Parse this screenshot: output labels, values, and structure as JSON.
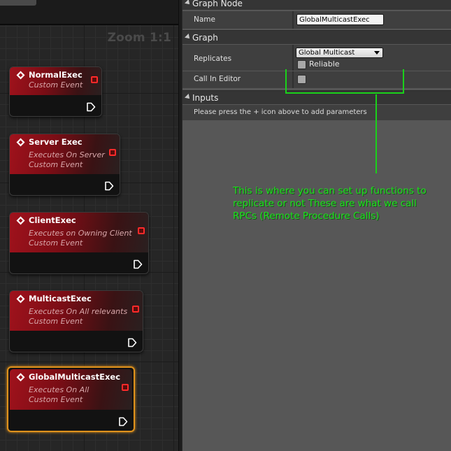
{
  "graph": {
    "zoom_label": "Zoom 1:1",
    "nodes": [
      {
        "title": "NormalExec",
        "subtitles": [
          "Custom Event"
        ]
      },
      {
        "title": "Server Exec",
        "subtitles": [
          "Executes On Server",
          "Custom Event"
        ]
      },
      {
        "title": "ClientExec",
        "subtitles": [
          "Executes on Owning Client",
          "Custom Event"
        ]
      },
      {
        "title": "MulticastExec",
        "subtitles": [
          "Executes On All relevants",
          "Custom Event"
        ]
      },
      {
        "title": "GlobalMulticastExec",
        "subtitles": [
          "Executes On All",
          "Custom Event"
        ]
      }
    ],
    "selected_node": "GlobalMulticastExec",
    "event_color": "#a0121c",
    "selection_color": "#e0921c"
  },
  "details": {
    "graph_node_section": {
      "title": "Graph Node",
      "name_label": "Name",
      "name_value": "GlobalMulticastExec"
    },
    "graph_section": {
      "title": "Graph",
      "replicates_label": "Replicates",
      "replicates_value": "Global Multicast",
      "reliable_label": "Reliable",
      "reliable_checked": false,
      "call_in_editor_label": "Call In Editor",
      "call_in_editor_checked": false
    },
    "inputs_section": {
      "title": "Inputs",
      "hint": "Please press the + icon above to add parameters"
    }
  },
  "annotation": {
    "text": "This is where you can set up functions to replicate or not These are what we call RPCs (Remote Procedure Calls)",
    "color": "#1ee01e"
  }
}
